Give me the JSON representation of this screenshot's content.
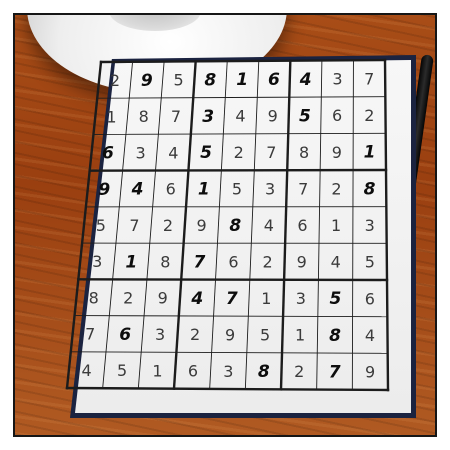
{
  "scene": {
    "objects": [
      "saucer-with-cup",
      "ballpoint-pen",
      "sudoku-puzzle-card",
      "wooden-table"
    ]
  },
  "sudoku": {
    "rows": [
      [
        "2",
        "9",
        "5",
        "8",
        "1",
        "6",
        "4",
        "3",
        "7"
      ],
      [
        "1",
        "8",
        "7",
        "3",
        "4",
        "9",
        "5",
        "6",
        "2"
      ],
      [
        "6",
        "3",
        "4",
        "5",
        "2",
        "7",
        "8",
        "9",
        "1"
      ],
      [
        "9",
        "4",
        "6",
        "1",
        "5",
        "3",
        "7",
        "2",
        "8"
      ],
      [
        "5",
        "7",
        "2",
        "9",
        "8",
        "4",
        "6",
        "1",
        "3"
      ],
      [
        "3",
        "1",
        "8",
        "7",
        "6",
        "2",
        "9",
        "4",
        "5"
      ],
      [
        "8",
        "2",
        "9",
        "4",
        "7",
        "1",
        "3",
        "5",
        "6"
      ],
      [
        "7",
        "6",
        "3",
        "2",
        "9",
        "5",
        "1",
        "8",
        "4"
      ],
      [
        "4",
        "5",
        "1",
        "6",
        "3",
        "8",
        "2",
        "7",
        "9"
      ]
    ],
    "bold_cells": [
      [
        0,
        1
      ],
      [
        0,
        3
      ],
      [
        0,
        4
      ],
      [
        0,
        5
      ],
      [
        0,
        6
      ],
      [
        1,
        3
      ],
      [
        1,
        6
      ],
      [
        2,
        0
      ],
      [
        2,
        3
      ],
      [
        2,
        8
      ],
      [
        3,
        0
      ],
      [
        3,
        1
      ],
      [
        3,
        3
      ],
      [
        3,
        8
      ],
      [
        4,
        4
      ],
      [
        5,
        1
      ],
      [
        5,
        3
      ],
      [
        6,
        3
      ],
      [
        6,
        4
      ],
      [
        6,
        7
      ],
      [
        7,
        1
      ],
      [
        7,
        7
      ],
      [
        8,
        5
      ],
      [
        8,
        7
      ]
    ]
  },
  "colors": {
    "table": "#9a3f10",
    "card_border": "#1b2340",
    "grid_lines": "#1c1c1c",
    "digit_light": "#3b3b3b",
    "digit_bold": "#0d0d0d"
  }
}
